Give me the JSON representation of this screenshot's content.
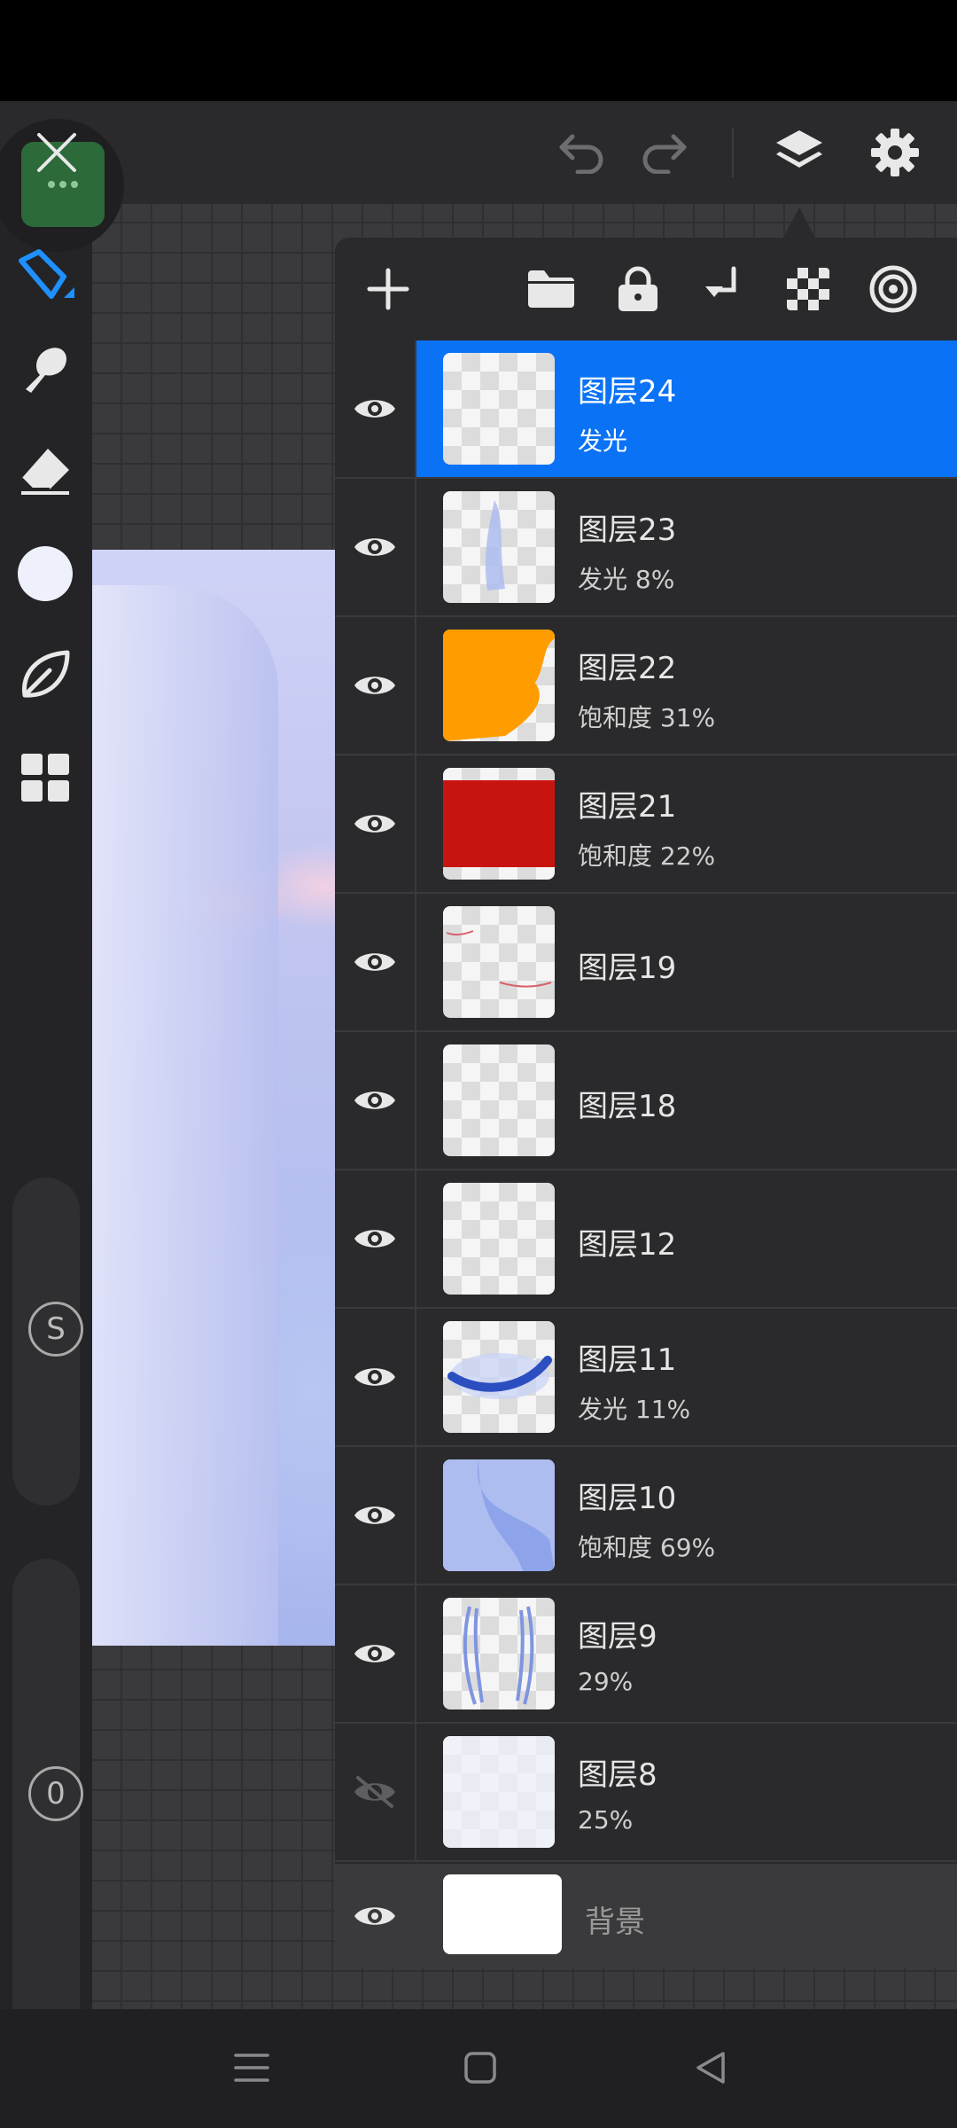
{
  "toolbar": {
    "undo_icon": "undo-icon",
    "redo_icon": "redo-icon",
    "layers_icon": "layers-icon",
    "settings_icon": "gear-icon",
    "close_icon": "close-icon",
    "accent": "#0a72f5"
  },
  "left_tools": [
    "pen-icon",
    "smudge-icon",
    "eraser-icon",
    "color-swatch",
    "leaf-brush-icon",
    "grid-icon"
  ],
  "sliders": {
    "size_label": "S",
    "opacity_label": "0"
  },
  "layers_panel": {
    "tools": [
      "add-icon",
      "folder-icon",
      "lock-icon",
      "merge-down-icon",
      "transparency-icon",
      "effect-icon"
    ],
    "layers": [
      {
        "name": "图层24",
        "sub": "发光",
        "selected": true,
        "visible": true,
        "thumb": "blank"
      },
      {
        "name": "图层23",
        "sub": "发光   8%",
        "selected": false,
        "visible": true,
        "thumb": "blue-stroke"
      },
      {
        "name": "图层22",
        "sub": "饱和度   31%",
        "selected": false,
        "visible": true,
        "thumb": "orange"
      },
      {
        "name": "图层21",
        "sub": "饱和度   22%",
        "selected": false,
        "visible": true,
        "thumb": "red"
      },
      {
        "name": "图层19",
        "sub": "",
        "selected": false,
        "visible": true,
        "thumb": "red-lines"
      },
      {
        "name": "图层18",
        "sub": "",
        "selected": false,
        "visible": true,
        "thumb": "blank"
      },
      {
        "name": "图层12",
        "sub": "",
        "selected": false,
        "visible": true,
        "thumb": "blank"
      },
      {
        "name": "图层11",
        "sub": "发光   11%",
        "selected": false,
        "visible": true,
        "thumb": "blue-curve"
      },
      {
        "name": "图层10",
        "sub": "饱和度   69%",
        "selected": false,
        "visible": true,
        "thumb": "light-blue"
      },
      {
        "name": "图层9",
        "sub": "29%",
        "selected": false,
        "visible": true,
        "thumb": "hair-strands"
      },
      {
        "name": "图层8",
        "sub": "25%",
        "selected": false,
        "visible": false,
        "thumb": "faint"
      }
    ],
    "background": {
      "name": "背景",
      "visible": true
    }
  },
  "navbar": [
    "menu-icon",
    "home-icon",
    "back-icon"
  ]
}
